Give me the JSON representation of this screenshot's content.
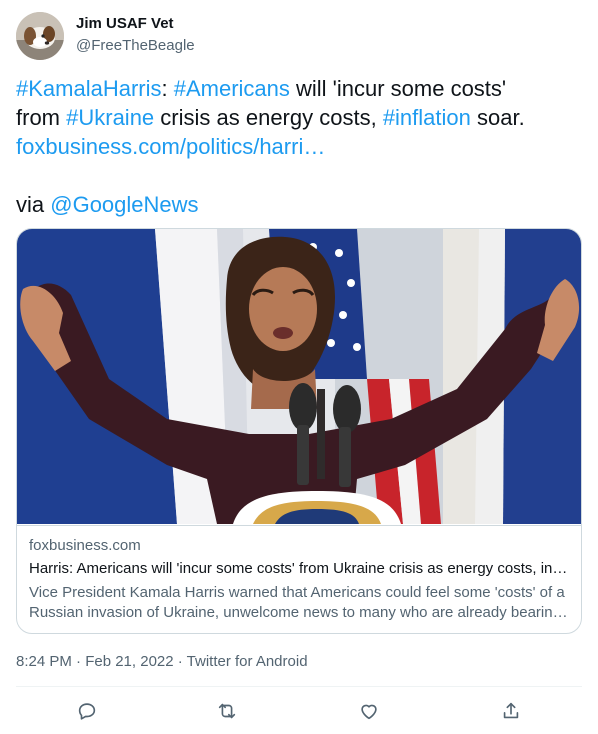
{
  "author": {
    "display_name": "Jim USAF Vet",
    "handle": "@FreeTheBeagle",
    "avatar_icon": "beagle-avatar"
  },
  "tweet": {
    "lines": [
      [
        {
          "text": "#KamalaHarris",
          "link": true
        },
        {
          "text": ": ",
          "link": false
        },
        {
          "text": "#Americans",
          "link": true
        },
        {
          "text": " will 'incur some costs'",
          "link": false
        }
      ],
      [
        {
          "text": "from ",
          "link": false
        },
        {
          "text": "#Ukraine",
          "link": true
        },
        {
          "text": " crisis as energy costs, ",
          "link": false
        },
        {
          "text": "#inflation",
          "link": true
        },
        {
          "text": " soar.",
          "link": false
        }
      ],
      [
        {
          "text": "foxbusiness.com/politics/harri…",
          "link": true
        }
      ],
      [],
      [
        {
          "text": "via ",
          "link": false
        },
        {
          "text": "@GoogleNews",
          "link": true
        }
      ]
    ]
  },
  "card": {
    "image_alt": "Kamala Harris speaking at a podium with raised arms in front of flags",
    "domain": "foxbusiness.com",
    "title": "Harris: Americans will 'incur some costs' from Ukraine crisis as energy costs, in…",
    "description_lines": [
      "Vice President Kamala Harris warned that Americans could feel some 'costs' of a",
      "Russian invasion of Ukraine, unwelcome news to many who are already bearing…"
    ]
  },
  "timestamp": "8:24 PM · Feb 21, 2022 · Twitter for Android",
  "actions": [
    "reply-icon",
    "retweet-icon",
    "like-icon",
    "share-icon"
  ],
  "colors": {
    "link": "#1d9bf0",
    "text": "#0f1419",
    "secondary": "#536471",
    "border": "#cfd9de"
  }
}
